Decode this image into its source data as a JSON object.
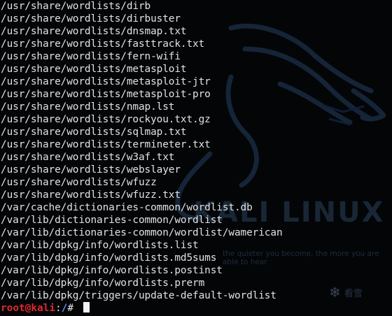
{
  "output_lines": [
    "/usr/share/wordlists/dirb",
    "/usr/share/wordlists/dirbuster",
    "/usr/share/wordlists/dnsmap.txt",
    "/usr/share/wordlists/fasttrack.txt",
    "/usr/share/wordlists/fern-wifi",
    "/usr/share/wordlists/metasploit",
    "/usr/share/wordlists/metasploit-jtr",
    "/usr/share/wordlists/metasploit-pro",
    "/usr/share/wordlists/nmap.lst",
    "/usr/share/wordlists/rockyou.txt.gz",
    "/usr/share/wordlists/sqlmap.txt",
    "/usr/share/wordlists/termineter.txt",
    "/usr/share/wordlists/w3af.txt",
    "/usr/share/wordlists/webslayer",
    "/usr/share/wordlists/wfuzz",
    "/usr/share/wordlists/wfuzz.txt",
    "/var/cache/dictionaries-common/wordlist.db",
    "/var/lib/dictionaries-common/wordlist",
    "/var/lib/dictionaries-common/wordlist/wamerican",
    "/var/lib/dpkg/info/wordlists.list",
    "/var/lib/dpkg/info/wordlists.md5sums",
    "/var/lib/dpkg/info/wordlists.postinst",
    "/var/lib/dpkg/info/wordlists.prerm",
    "/var/lib/dpkg/triggers/update-default-wordlist"
  ],
  "prompt": {
    "user": "root",
    "at": "@",
    "host": "kali",
    "colon": ":",
    "path": "/",
    "symbol": "# "
  },
  "watermark": {
    "brand": "KALI LINUX",
    "tagline": "the quieter you become, the more you are able to hear",
    "badge_text": "看雪",
    "badge_icon": "snowflake-icon"
  },
  "colors": {
    "background": "#030507",
    "text": "#e2e2e2",
    "prompt_user": "#e0272f",
    "prompt_path": "#6b8cff"
  }
}
